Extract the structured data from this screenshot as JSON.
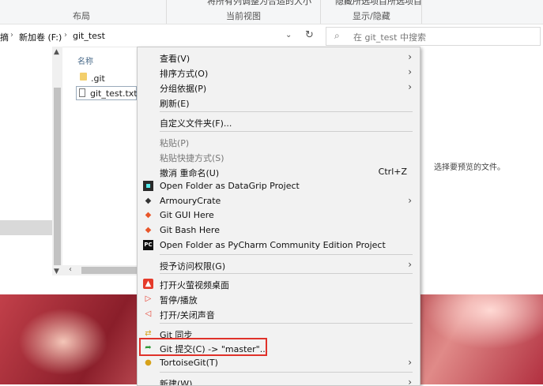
{
  "ribbon": {
    "cut_text_1": "将所有列调整为合适的大小",
    "cut_text_2": "隐藏所选项目",
    "cut_text_3": "所选项目",
    "group_layout": "布局",
    "group_current_view": "当前视图",
    "group_show_hide": "显示/隐藏"
  },
  "address_bar": {
    "crumb_1": "摘",
    "crumb_2": "新加卷 (F:)",
    "crumb_3": "git_test",
    "search_placeholder": "在 git_test 中搜索"
  },
  "file_list": {
    "column_name": "名称",
    "files": [
      {
        "name": ".git",
        "icon": "folder-icon"
      },
      {
        "name": "git_test.txt",
        "icon": "text-file-icon"
      }
    ]
  },
  "preview": {
    "empty_text": "选择要预览的文件。"
  },
  "context_menu": {
    "view": "查看(V)",
    "sort_by": "排序方式(O)",
    "group_by": "分组依据(P)",
    "refresh": "刷新(E)",
    "customize_folder": "自定义文件夹(F)...",
    "paste": "粘贴(P)",
    "paste_shortcut": "粘贴快捷方式(S)",
    "undo_rename": "撤消 重命名(U)",
    "undo_shortcut": "Ctrl+Z",
    "datagrip": "Open Folder as DataGrip Project",
    "armoury": "ArmouryCrate",
    "git_gui": "Git GUI Here",
    "git_bash": "Git Bash Here",
    "pycharm": "Open Folder as PyCharm Community Edition Project",
    "grant_access": "授予访问权限(G)",
    "open_huorong": "打开火萤视频桌面",
    "pause_play": "暂停/播放",
    "toggle_sound": "打开/关闭声音",
    "git_sync": "Git 同步",
    "git_commit": "Git 提交(C) -> \"master\"...",
    "tortoisegit": "TortoiseGit(T)",
    "new": "新建(W)"
  },
  "colors": {
    "highlight_border": "#e0322a",
    "menu_bg": "#f2f2f2",
    "wallpaper_red": "#c2404a"
  }
}
